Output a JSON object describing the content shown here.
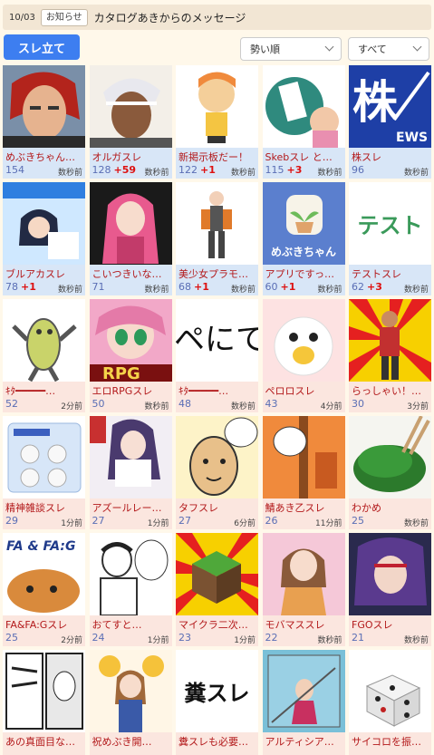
{
  "header": {
    "date": "10/03",
    "notice_badge": "お知らせ",
    "message": "カタログあきからのメッセージ"
  },
  "toolbar": {
    "new_thread": "スレ立て",
    "sort": "勢い順",
    "filter": "すべて"
  },
  "threads": [
    {
      "title": "めぶきちゃん…",
      "count": "154",
      "plus": "",
      "time": "数秒前",
      "theme": "blue",
      "icon": "red-haired-pirate-thumbnail"
    },
    {
      "title": "オルガスレ",
      "count": "128",
      "plus": "+59",
      "time": "数秒前",
      "theme": "blue",
      "icon": "white-haired-man-thumbnail"
    },
    {
      "title": "新掲示板だー！",
      "count": "122",
      "plus": "+1",
      "time": "数秒前",
      "theme": "blue",
      "icon": "chibi-girl-thumbnail"
    },
    {
      "title": "Skebスレ と…",
      "count": "115",
      "plus": "+3",
      "time": "数秒前",
      "theme": "blue",
      "icon": "skeb-logo-thumbnail"
    },
    {
      "title": "株スレ",
      "count": "96",
      "plus": "",
      "time": "数秒前",
      "theme": "blue",
      "icon": "stock-news-logo-thumbnail"
    },
    {
      "title": "ブルアカスレ",
      "count": "78",
      "plus": "+1",
      "time": "数秒前",
      "theme": "blue",
      "icon": "blue-archive-thumbnail"
    },
    {
      "title": "こいつきいな…",
      "count": "71",
      "plus": "",
      "time": "数秒前",
      "theme": "blue",
      "icon": "pink-haired-girl-thumbnail"
    },
    {
      "title": "美少女プラモ…",
      "count": "68",
      "plus": "+1",
      "time": "数秒前",
      "theme": "blue",
      "icon": "mecha-girl-figure-thumbnail"
    },
    {
      "title": "アプリですっ…",
      "count": "60",
      "plus": "+1",
      "time": "数秒前",
      "theme": "blue",
      "icon": "mebuki-app-icon-thumbnail",
      "caption": "めぶきちゃん"
    },
    {
      "title": "テストスレ",
      "count": "62",
      "plus": "+3",
      "time": "数秒前",
      "theme": "blue",
      "icon": "test-text-thumbnail",
      "caption": "テスト"
    },
    {
      "title": "ｷﾀ━━━━━…",
      "count": "52",
      "plus": "",
      "time": "2分前",
      "theme": "red",
      "icon": "ascii-creature-thumbnail"
    },
    {
      "title": "エロRPGスレ",
      "count": "50",
      "plus": "",
      "time": "数秒前",
      "theme": "red",
      "icon": "rpg-girl-thumbnail",
      "caption": "RPG"
    },
    {
      "title": "ｷﾀ━━━━━…",
      "count": "48",
      "plus": "",
      "time": "数秒前",
      "theme": "red",
      "icon": "text-fragment-thumbnail",
      "caption": "ペにて"
    },
    {
      "title": "ペロロスレ",
      "count": "43",
      "plus": "",
      "time": "4分前",
      "theme": "red",
      "icon": "white-bird-thumbnail"
    },
    {
      "title": "らっしゃい！…",
      "count": "30",
      "plus": "",
      "time": "3分前",
      "theme": "red",
      "icon": "dancing-man-thumbnail"
    },
    {
      "title": "精神雑談スレ",
      "count": "29",
      "plus": "",
      "time": "1分前",
      "theme": "red",
      "icon": "pill-pack-thumbnail"
    },
    {
      "title": "アズールレー…",
      "count": "27",
      "plus": "",
      "time": "1分前",
      "theme": "red",
      "icon": "azur-lane-thumbnail"
    },
    {
      "title": "タフスレ",
      "count": "27",
      "plus": "",
      "time": "6分前",
      "theme": "red",
      "icon": "manga-man-thumbnail"
    },
    {
      "title": "鯖あき乙スレ",
      "count": "26",
      "plus": "",
      "time": "11分前",
      "theme": "red",
      "icon": "chained-girl-thumbnail"
    },
    {
      "title": "わかめ",
      "count": "25",
      "plus": "",
      "time": "数秒前",
      "theme": "red",
      "icon": "seaweed-bowl-thumbnail"
    },
    {
      "title": "FA&FA:Gスレ",
      "count": "25",
      "plus": "",
      "time": "2分前",
      "theme": "red",
      "icon": "fa-cat-thumbnail",
      "caption": "FA & FA:G"
    },
    {
      "title": "おてすと…",
      "count": "24",
      "plus": "",
      "time": "1分前",
      "theme": "red",
      "icon": "manga-sketch-thumbnail"
    },
    {
      "title": "マイクラ二次…",
      "count": "23",
      "plus": "",
      "time": "1分前",
      "theme": "red",
      "icon": "minecraft-block-thumbnail"
    },
    {
      "title": "モバマススレ",
      "count": "22",
      "plus": "",
      "time": "数秒前",
      "theme": "red",
      "icon": "idol-girl-thumbnail"
    },
    {
      "title": "FGOスレ",
      "count": "21",
      "plus": "",
      "time": "数秒前",
      "theme": "red",
      "icon": "fgo-character-thumbnail"
    },
    {
      "title": "あの真面目な…",
      "count": "",
      "plus": "",
      "time": "",
      "theme": "red",
      "icon": "manga-panel-thumbnail"
    },
    {
      "title": "祝めぶき開…",
      "count": "",
      "plus": "",
      "time": "",
      "theme": "red",
      "icon": "cheerleader-thumbnail"
    },
    {
      "title": "糞スレも必要…",
      "count": "",
      "plus": "",
      "time": "",
      "theme": "red",
      "icon": "kuso-text-thumbnail",
      "caption": "糞スレ"
    },
    {
      "title": "アルティシア…",
      "count": "",
      "plus": "",
      "time": "",
      "theme": "red",
      "icon": "anime-scene-thumbnail"
    },
    {
      "title": "サイコロを振…",
      "count": "",
      "plus": "",
      "time": "",
      "theme": "red",
      "icon": "dice-thumbnail"
    }
  ]
}
